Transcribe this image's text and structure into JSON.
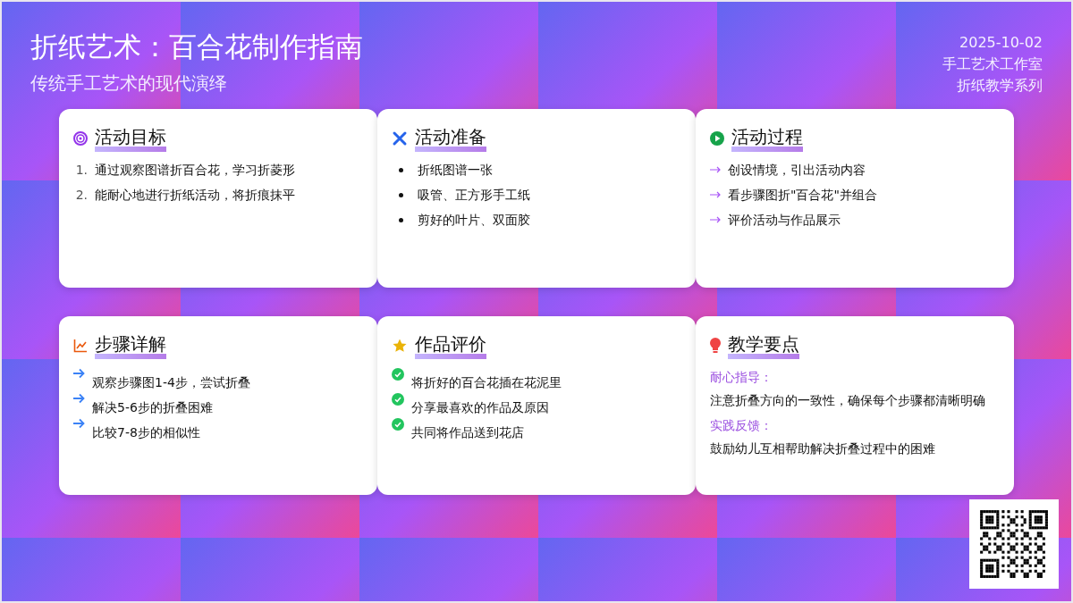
{
  "header": {
    "title": "折纸艺术：百合花制作指南",
    "subtitle": "传统手工艺术的现代演绎",
    "meta": [
      "2025-10-02",
      "手工艺术工作室",
      "折纸教学系列"
    ]
  },
  "cards": [
    {
      "kind": "ordered",
      "title": "活动目标",
      "items": [
        {
          "number": "1.",
          "text": "通过观察图谱折百合花，学习折菱形"
        },
        {
          "number": "2.",
          "text": "能耐心地进行折纸活动，将折痕抹平"
        }
      ]
    },
    {
      "kind": "bullet",
      "title": "活动准备",
      "items": [
        {
          "text": "折纸图谱一张"
        },
        {
          "text": "吸管、正方形手工纸"
        },
        {
          "text": "剪好的叶片、双面胶"
        }
      ]
    },
    {
      "kind": "arrow",
      "title": "活动过程",
      "items": [
        {
          "text": "创设情境，引出活动内容"
        },
        {
          "text": "看步骤图折\"百合花\"并组合"
        },
        {
          "text": "评价活动与作品展示"
        }
      ]
    },
    {
      "kind": "step",
      "title": "步骤详解",
      "items": [
        {
          "text": "观察步骤图1-4步，尝试折叠"
        },
        {
          "text": "解决5-6步的折叠困难"
        },
        {
          "text": "比较7-8步的相似性"
        }
      ]
    },
    {
      "kind": "check",
      "title": "作品评价",
      "items": [
        {
          "text": "将折好的百合花插在花泥里"
        },
        {
          "text": "分享最喜欢的作品及原因"
        },
        {
          "text": "共同将作品送到花店"
        }
      ]
    },
    {
      "kind": "notes",
      "title": "教学要点",
      "items": [
        {
          "label": "耐心指导：",
          "text": "注意折叠方向的一致性，确保每个步骤都清晰明确"
        },
        {
          "label": "实践反馈：",
          "text": "鼓励幼儿互相帮助解决折叠过程中的困难"
        }
      ]
    }
  ]
}
